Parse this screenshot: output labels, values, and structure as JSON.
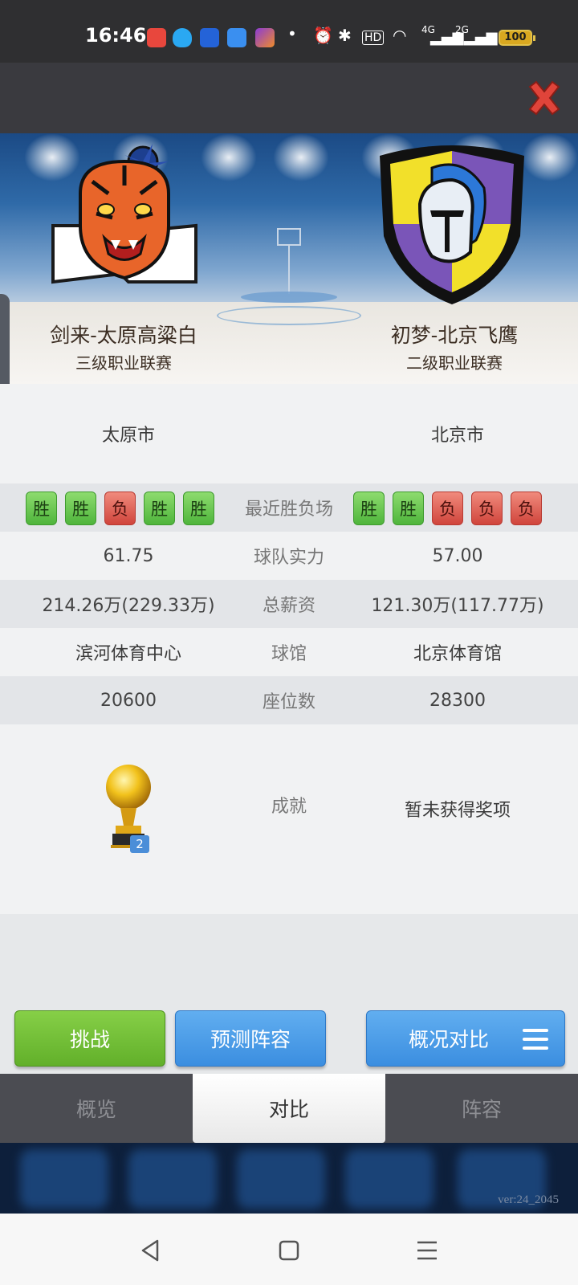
{
  "status_bar": {
    "time": "16:46",
    "network_4g": "4G",
    "network_2g": "2G",
    "battery": "100",
    "hd": "HD"
  },
  "team_left": {
    "name": "剑来-太原高粱白",
    "league": "三级职业联赛",
    "logo_icon": "tiger-logo-icon",
    "city": "太原市",
    "recent": [
      "胜",
      "胜",
      "负",
      "胜",
      "胜"
    ],
    "strength": "61.75",
    "salary": "214.26万(229.33万)",
    "arena": "滨河体育中心",
    "seats": "20600",
    "trophy_count": "2"
  },
  "team_right": {
    "name": "初梦-北京飞鹰",
    "league": "二级职业联赛",
    "logo_icon": "spartan-helmet-logo-icon",
    "city": "北京市",
    "recent": [
      "胜",
      "胜",
      "负",
      "负",
      "负"
    ],
    "strength": "57.00",
    "salary": "121.30万(117.77万)",
    "arena": "北京体育馆",
    "seats": "28300",
    "achievement": "暂未获得奖项"
  },
  "labels": {
    "recent": "最近胜负场",
    "strength": "球队实力",
    "salary": "总薪资",
    "arena": "球馆",
    "seats": "座位数",
    "achievement": "成就"
  },
  "actions": {
    "challenge": "挑战",
    "predict_lineup": "预测阵容",
    "overview_compare": "概况对比"
  },
  "tabs": [
    {
      "label": "概览",
      "active": false
    },
    {
      "label": "对比",
      "active": true
    },
    {
      "label": "阵容",
      "active": false
    }
  ],
  "version": "ver:24_2045",
  "colors": {
    "win": "#5cbf45",
    "loss": "#d9534b",
    "challenge_button": "#6cb830",
    "blue_button": "#4a9ae6",
    "close": "#e0443a"
  }
}
